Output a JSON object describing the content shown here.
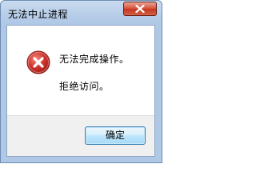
{
  "window": {
    "title": "无法中止进程"
  },
  "dialog": {
    "message_line1": "无法完成操作。",
    "message_line2": "拒绝访问。",
    "ok_label": "确定",
    "icon": "error-icon"
  },
  "colors": {
    "title_bar": "#b7cde8",
    "close_button": "#c6361f",
    "error_icon": "#d0312d",
    "footer": "#f0f0f0"
  }
}
